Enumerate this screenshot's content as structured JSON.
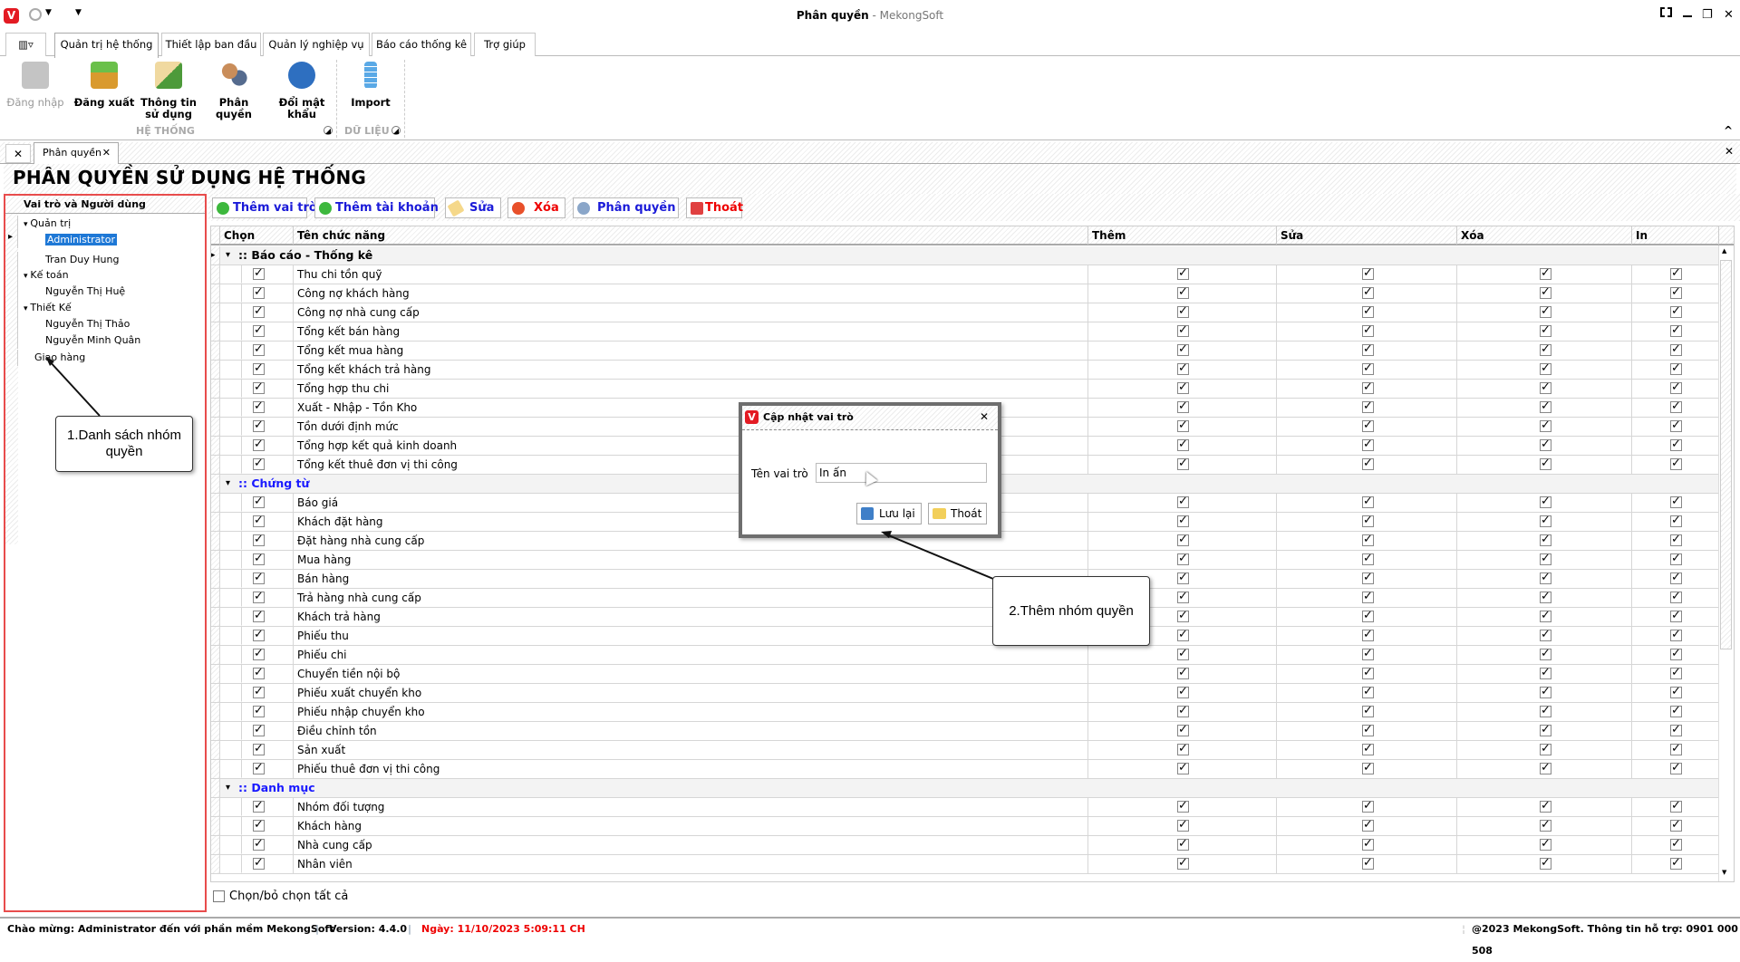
{
  "window": {
    "title": "Phân quyền",
    "title_suffix": " - MekongSoft"
  },
  "ribbon_tabs": [
    "Quản trị hệ thống",
    "Thiết lập ban đầu",
    "Quản lý nghiệp vụ",
    "Báo cáo thống kê",
    "Trợ giúp"
  ],
  "ribbon": {
    "buttons": [
      {
        "label": "Đăng nhập",
        "icon": "lock-icon",
        "color": "#bdbdbd",
        "disabled": true
      },
      {
        "label": "Đăng xuất",
        "icon": "logout-lock-icon",
        "color": "#e0a030"
      },
      {
        "label": "Thông tin sử dụng",
        "icon": "user-info-icon",
        "color": "#6aa84f"
      },
      {
        "label": "Phân quyền",
        "icon": "users-key-icon",
        "color": "#c9a063"
      },
      {
        "label": "Đổi mật khẩu",
        "icon": "change-password-icon",
        "color": "#2e6fc0"
      },
      {
        "label": "Import",
        "icon": "database-icon",
        "color": "#4a90d9"
      }
    ],
    "groups": [
      "HỆ THỐNG",
      "DỮ LIỆU"
    ]
  },
  "doc_tab": "Phân quyền",
  "page_title": "PHÂN QUYỀN SỬ DỤNG HỆ THỐNG",
  "tree": {
    "header": "Vai trò và Người dùng",
    "nodes": [
      {
        "label": "Quản trị",
        "level": 0,
        "expanded": true
      },
      {
        "label": "Administrator",
        "level": 1,
        "selected": true
      },
      {
        "label": "Tran Duy Hung",
        "level": 1
      },
      {
        "label": "Kế toán",
        "level": 0,
        "expanded": true
      },
      {
        "label": "Nguyễn Thị Huệ",
        "level": 1
      },
      {
        "label": "Thiết Kế",
        "level": 0,
        "expanded": true
      },
      {
        "label": "Nguyễn Thị Thảo",
        "level": 1
      },
      {
        "label": "Nguyễn Minh Quân",
        "level": 1
      },
      {
        "label": "Giao hàng",
        "level": 0
      }
    ]
  },
  "toolbar": {
    "add_role": "Thêm vai trò",
    "add_account": "Thêm tài khoản",
    "edit": "Sửa",
    "delete": "Xóa",
    "permissions": "Phân quyền",
    "exit": "Thoát"
  },
  "grid": {
    "columns": [
      "Chọn",
      "Tên chức năng",
      "Thêm",
      "Sửa",
      "Xóa",
      "In"
    ],
    "groups": [
      {
        "name": ":: Báo cáo - Thống kê",
        "color": "#000000",
        "items": [
          "Thu chi tồn quỹ",
          "Công nợ khách hàng",
          "Công nợ nhà cung cấp",
          "Tổng kết bán hàng",
          "Tổng kết mua hàng",
          "Tổng kết khách trả hàng",
          "Tổng hợp thu chi",
          "Xuất - Nhập - Tồn Kho",
          "Tồn dưới định mức",
          "Tổng hợp kết quả kinh doanh",
          "Tổng kết thuê đơn vị thi công"
        ]
      },
      {
        "name": ":: Chứng từ",
        "color": "#1a1aff",
        "items": [
          "Báo giá",
          "Khách đặt hàng",
          "Đặt hàng nhà cung cấp",
          "Mua hàng",
          "Bán hàng",
          "Trả hàng nhà cung cấp",
          "Khách trả hàng",
          "Phiếu thu",
          "Phiếu chi",
          "Chuyển tiền nội bộ",
          "Phiếu xuất chuyển kho",
          "Phiếu nhập chuyển kho",
          "Điều chỉnh tồn",
          "Sản xuất",
          "Phiếu thuê đơn vị thi công"
        ]
      },
      {
        "name": ":: Danh mục",
        "color": "#1a1aff",
        "items": [
          "Nhóm đối tượng",
          "Khách hàng",
          "Nhà cung cấp",
          "Nhân viên"
        ]
      }
    ],
    "all_checked": true,
    "select_all_label": "Chọn/bỏ chọn tất cả",
    "select_all_checked": false
  },
  "dialog": {
    "title": "Cập nhật vai trò",
    "field_label": "Tên vai trò",
    "field_value": "In ấn",
    "save": "Lưu lại",
    "exit": "Thoát"
  },
  "callouts": {
    "one": "1.Danh sách nhóm quyền",
    "two": "2.Thêm nhóm quyền"
  },
  "status": {
    "welcome": "Chào mừng: Administrator đến với phần mềm MekongSoft",
    "version": "Version: 4.4.0",
    "date": "Ngày: 11/10/2023 5:09:11 CH",
    "copyright": "@2023 MekongSoft. Thông tin hỗ trợ: 0901 000 508"
  }
}
